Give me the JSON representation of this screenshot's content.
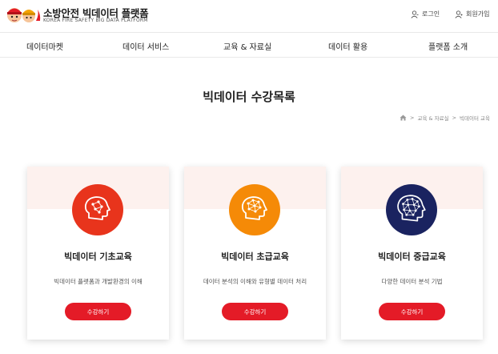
{
  "brand": {
    "title": "소방안전 빅데이터 플랫폼",
    "subtitle": "KOREA FIRE SAFETY BIG DATA PLATFORM",
    "accent": "#e41b27"
  },
  "auth": {
    "login_label": "로그인",
    "join_label": "회원가입"
  },
  "nav": {
    "items": [
      {
        "label": "데이터마켓"
      },
      {
        "label": "데이터 서비스"
      },
      {
        "label": "교육 & 자료실"
      },
      {
        "label": "데이터 활용"
      },
      {
        "label": "플랫폼 소개"
      }
    ]
  },
  "page": {
    "title": "빅데이터 수강목록"
  },
  "breadcrumb": {
    "icon": "home-icon",
    "separator": ">",
    "items": [
      "교육 & 자료실",
      "빅데이터 교육"
    ]
  },
  "courses": [
    {
      "title": "빅데이터 기초교육",
      "desc": "빅데이터 플랫폼과 개발환경의 이해",
      "button": "수강하기",
      "icon": "brain-network-icon",
      "color": "#e8341c"
    },
    {
      "title": "빅데이터 초급교육",
      "desc": "데이터 분석의 이해와 유형별 데이터 처리",
      "button": "수강하기",
      "icon": "brain-network-icon",
      "color": "#f58a07"
    },
    {
      "title": "빅데이터 중급교육",
      "desc": "다양한 데이터 분석 기법",
      "button": "수강하기",
      "icon": "brain-network-icon",
      "color": "#1a2360"
    }
  ]
}
